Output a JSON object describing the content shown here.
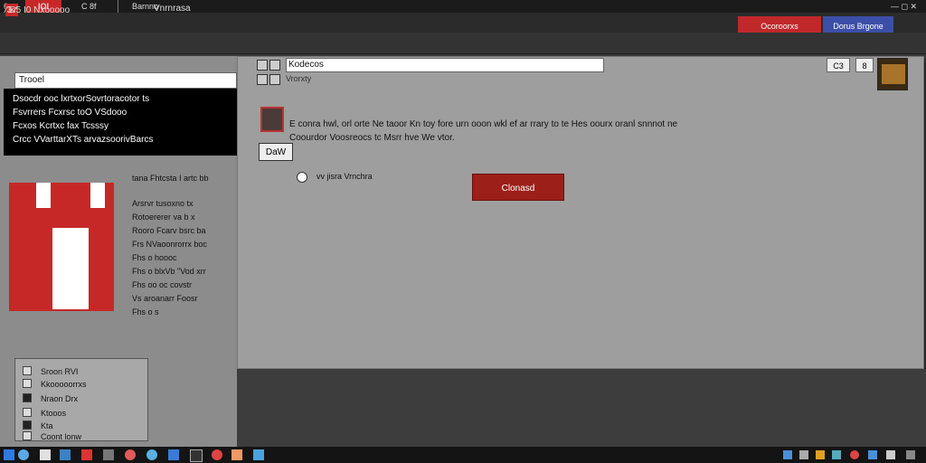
{
  "topbar": {
    "a": "6",
    "b": "IOI",
    "c": "C 8f",
    "d": "Barnno",
    "win": "—  ◻  ✕"
  },
  "menubar": {
    "icon": "☒",
    "title": "Vnrnrasa"
  },
  "toolbar": {
    "red_button": "Ocoroorxs",
    "blue_button": "Dorus Brgone"
  },
  "tabrow": {
    "text": "⁄3  ⁄5  I0  Nxooooo"
  },
  "left": {
    "search_value": "Trooel",
    "desc_lines": [
      "Dsocdr  ooc   lxrtxorSovrtoracotor  ts",
      "Fsvrrers   Fcxrsc  toO  VSdooo",
      "Fcxos  Kcrtxc  fax  Tcsssy",
      "Crcc   VVarttarXTs  arvazsoorivBarcs"
    ],
    "side_heading": "tana  Fhtcsta  I artc  bb",
    "side_lines": [
      "Arsrvr   tusoxno  tx",
      "Rotoererer   va   b   x",
      "Rooro   Fcarv   bsrc  ba",
      "Frs  NVaoonrorrx  boc",
      "Fhs  o  hoooc",
      "Fhs  o  blxVb   \"Vod  xrr",
      "Fhs  oo   oc   covstr",
      "Vs  aroanarr  Foosr",
      "Fhs  o  s"
    ],
    "list_items": [
      {
        "label": "Sroon  RVI",
        "checked": false
      },
      {
        "label": "Kkooooorrxs",
        "checked": false
      },
      {
        "label": "Nraon  Drx",
        "checked": true
      },
      {
        "label": "Ktooos",
        "checked": false
      },
      {
        "label": "Kta",
        "checked": true
      },
      {
        "label": "Coont  lonw",
        "checked": false
      }
    ]
  },
  "dialog": {
    "title_input": "Kodecos",
    "subtitle": "Vrorxty",
    "close_label": "C3",
    "max_label": "8",
    "message_lines": [
      "E conra hwl, orl orte  Ne  taoor  Kn  toy  fore  urn ooon wkl  ef  ar  rrary  to  te  Hes  oourx  oranl  snnnot  ne",
      "Coourdor   Voosreocs   tc   Msrr hve   We  vtor."
    ],
    "small_button": "DaW",
    "radio_label": "vv  jisra  Vrnchra",
    "primary_button": "Clonasd"
  },
  "colors": {
    "accent_red": "#c62828",
    "accent_blue": "#3c4fa8",
    "dialog_bg": "#9e9e9e",
    "primary_btn": "#9c1f1a"
  },
  "icons": {
    "taskbar": [
      "windows-icon",
      "search-icon",
      "explorer-icon",
      "browser-icon",
      "app-icon",
      "mail-icon",
      "settings-icon",
      "media-icon",
      "folder-icon",
      "terminal-icon",
      "chrome-icon",
      "photos-icon",
      "store-icon"
    ],
    "tray": [
      "network-icon",
      "volume-icon",
      "battery-icon",
      "chat-icon",
      "chrome-icon",
      "calendar-icon",
      "notifications-icon",
      "clock-icon"
    ]
  }
}
